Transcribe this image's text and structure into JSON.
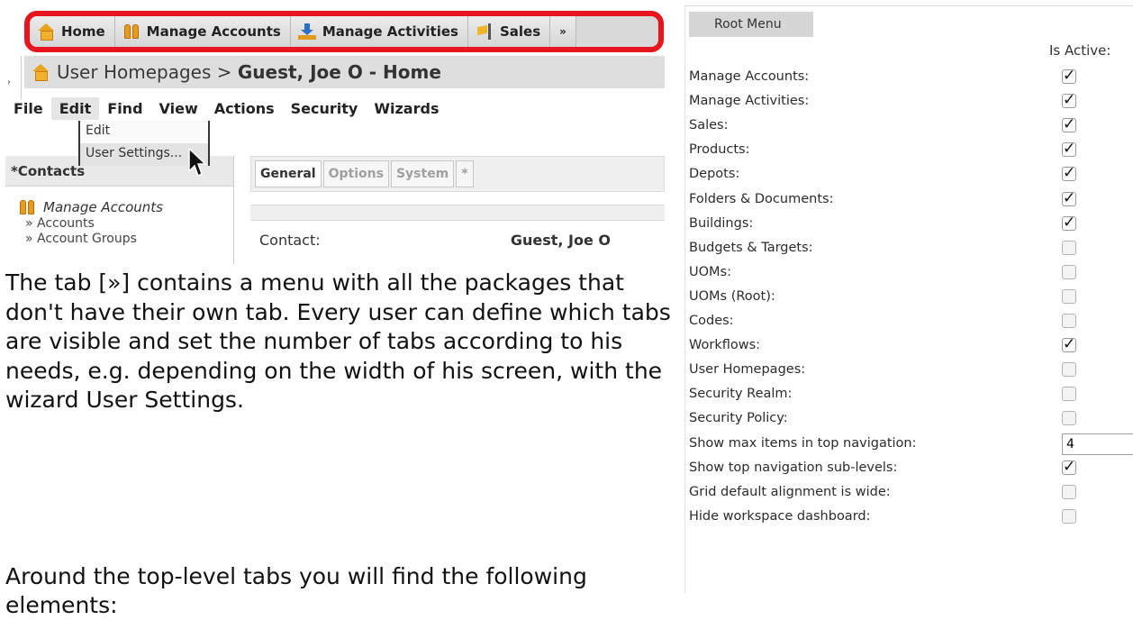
{
  "tabs": [
    {
      "label": "Home",
      "icon": "home-icon"
    },
    {
      "label": "Manage Accounts",
      "icon": "people-icon"
    },
    {
      "label": "Manage Activities",
      "icon": "activities-icon"
    },
    {
      "label": "Sales",
      "icon": "sales-flag-icon"
    }
  ],
  "more_tab": "»",
  "breadcrumb": {
    "prefix": "User Homepages > ",
    "current": "Guest, Joe O - Home"
  },
  "menu": [
    "File",
    "Edit",
    "Find",
    "View",
    "Actions",
    "Security",
    "Wizards"
  ],
  "edit_menu": [
    "Edit",
    "User Settings..."
  ],
  "contacts_panel": {
    "title": "*Contacts",
    "section": "Manage Accounts",
    "links": [
      "» Accounts",
      "» Account Groups"
    ]
  },
  "detail_tabs": [
    "General",
    "Options",
    "System",
    "*"
  ],
  "contact": {
    "label": "Contact:",
    "value": "Guest, Joe O"
  },
  "paragraph1": "The tab [»] contains a menu with all the packages that don't have their own tab. Every user can define which tabs are visible and set the number of tabs according to his needs, e.g. depending on the width of his screen, with the wizard User Settings.",
  "paragraph2": "Around the top-level tabs you will find the following elements:",
  "root_menu": {
    "title": "Root Menu",
    "active_header": "Is Active:",
    "rows": [
      {
        "label": "Manage Accounts:",
        "checked": true
      },
      {
        "label": "Manage Activities:",
        "checked": true
      },
      {
        "label": "Sales:",
        "checked": true
      },
      {
        "label": "Products:",
        "checked": true
      },
      {
        "label": "Depots:",
        "checked": true
      },
      {
        "label": "Folders & Documents:",
        "checked": true
      },
      {
        "label": "Buildings:",
        "checked": true
      },
      {
        "label": "Budgets & Targets:",
        "checked": false
      },
      {
        "label": "UOMs:",
        "checked": false
      },
      {
        "label": "UOMs (Root):",
        "checked": false
      },
      {
        "label": "Codes:",
        "checked": false
      },
      {
        "label": "Workflows:",
        "checked": true
      },
      {
        "label": "User Homepages:",
        "checked": false
      },
      {
        "label": "Security Realm:",
        "checked": false
      },
      {
        "label": "Security Policy:",
        "checked": false
      },
      {
        "label": "Show max items in top navigation:",
        "input": "4"
      },
      {
        "label": "Show top navigation sub-levels:",
        "checked": true
      },
      {
        "label": "Grid default alignment is wide:",
        "checked": false
      },
      {
        "label": "Hide workspace dashboard:",
        "checked": false
      }
    ]
  },
  "colors": {
    "highlight_border": "#e8141e",
    "tab_bg": "#d9d9d9",
    "breadcrumb_bg": "#dedede"
  }
}
